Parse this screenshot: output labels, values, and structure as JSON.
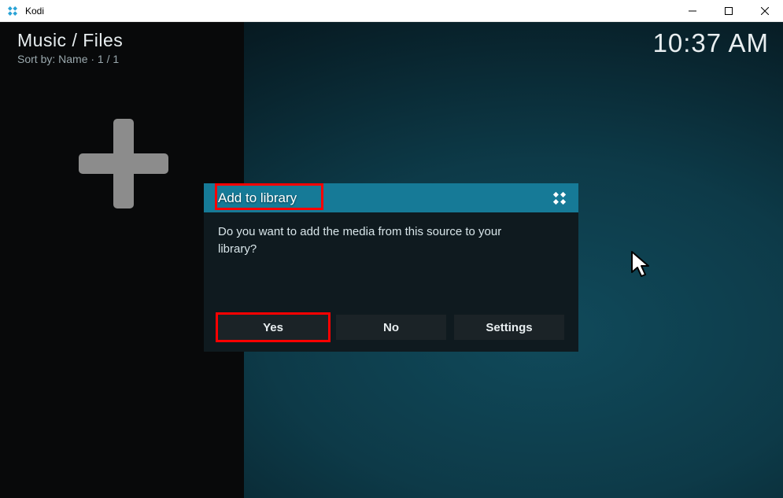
{
  "window": {
    "title": "Kodi"
  },
  "header": {
    "breadcrumb": "Music / Files",
    "sort_line": "Sort by: Name  ·  1 / 1"
  },
  "clock": "10:37 AM",
  "dialog": {
    "title": "Add to library",
    "message": "Do you want to add the media from this source to your library?",
    "buttons": {
      "yes": "Yes",
      "no": "No",
      "settings": "Settings"
    }
  }
}
